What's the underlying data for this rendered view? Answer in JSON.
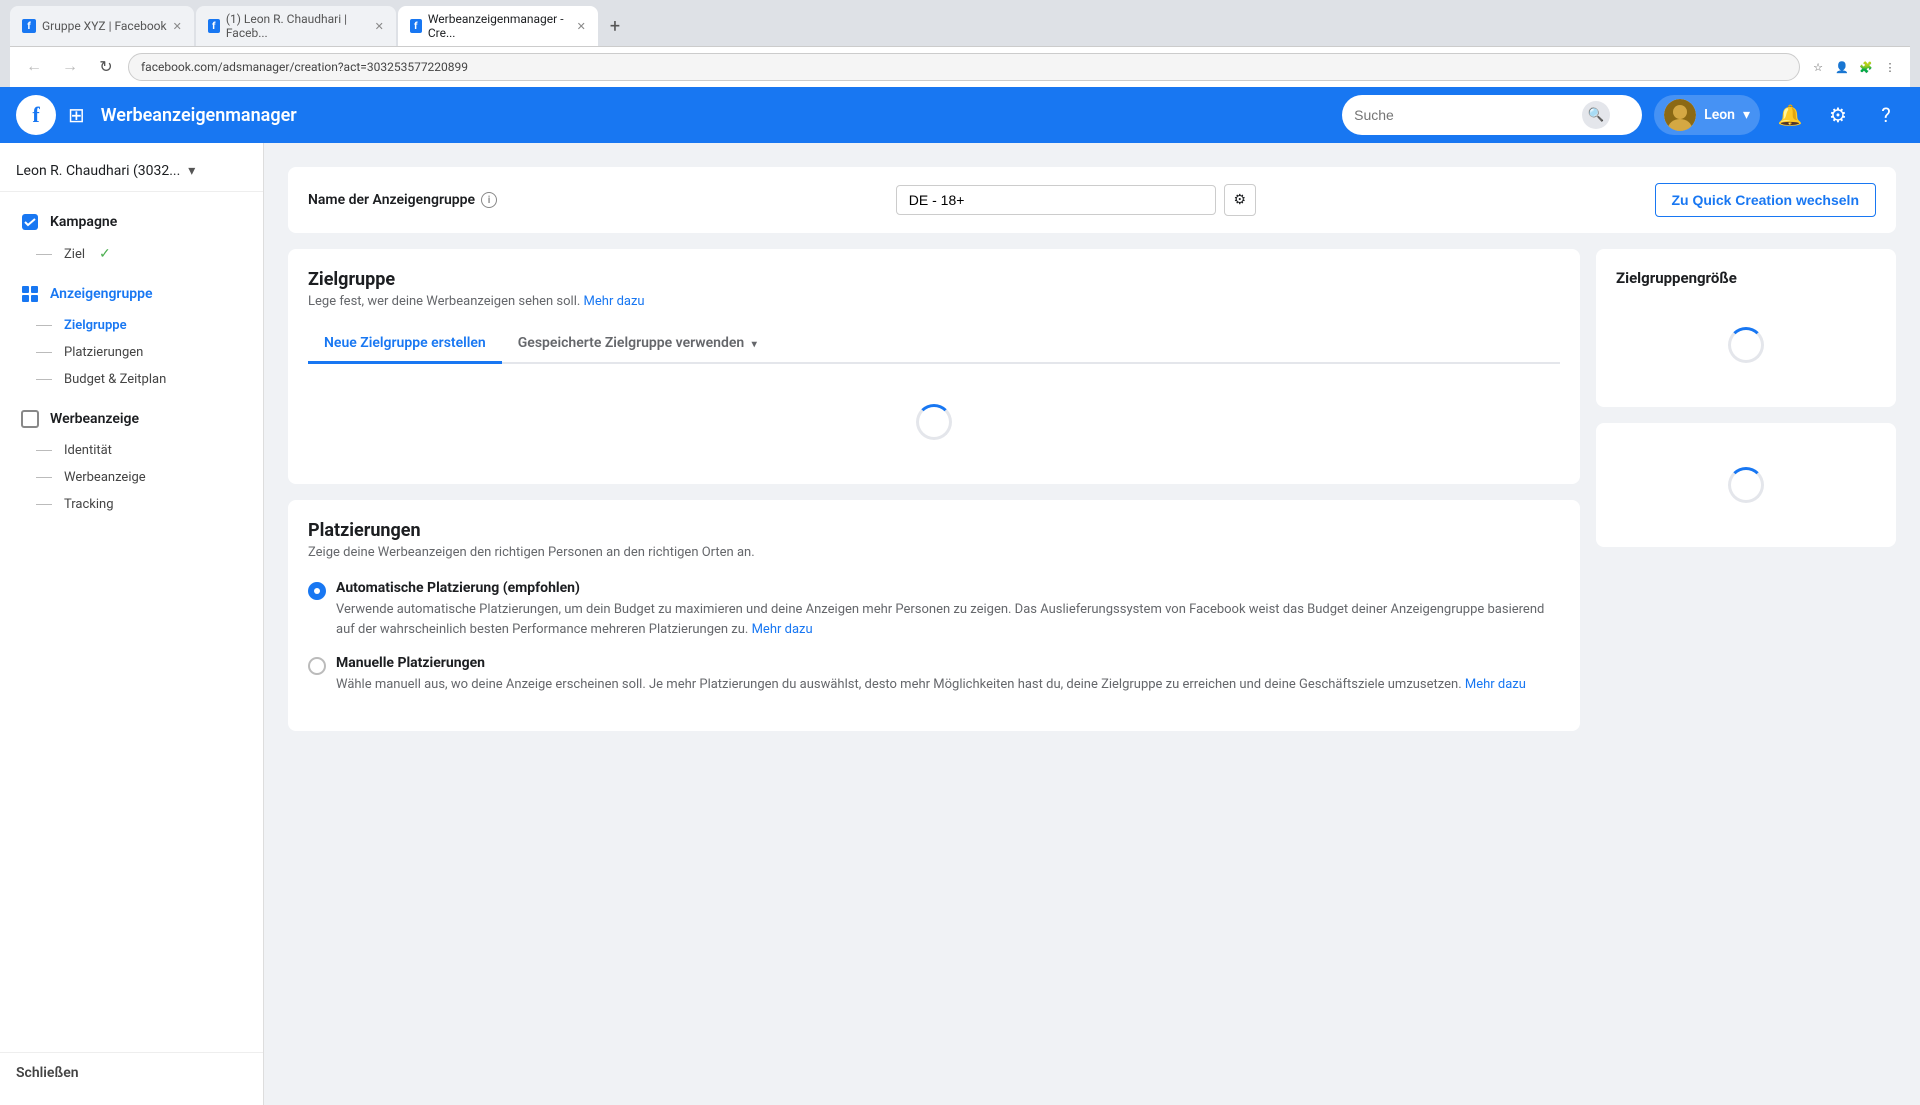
{
  "browser": {
    "tabs": [
      {
        "id": "tab1",
        "label": "Gruppe XYZ | Facebook",
        "favicon_color": "#1877f2",
        "favicon_text": "f",
        "active": false
      },
      {
        "id": "tab2",
        "label": "(1) Leon R. Chaudhari | Faceb...",
        "favicon_color": "#1877f2",
        "favicon_text": "f",
        "active": false
      },
      {
        "id": "tab3",
        "label": "Werbeanzeigenmanager - Cre...",
        "favicon_color": "#1877f2",
        "favicon_text": "f",
        "active": true
      }
    ],
    "new_tab_label": "+",
    "url": "facebook.com/adsmanager/creation?act=303253577220899"
  },
  "header": {
    "app_name": "Werbeanzeigenmanager",
    "search_placeholder": "Suche",
    "user_name": "Leon",
    "notifications_icon": "bell-icon",
    "settings_icon": "gear-icon",
    "help_icon": "question-icon"
  },
  "sidebar": {
    "account_name": "Leon R. Chaudhari (3032...",
    "sections": [
      {
        "id": "kampagne",
        "label": "Kampagne",
        "icon": "checkbox-icon",
        "sub_items": [
          {
            "id": "ziel",
            "label": "Ziel",
            "status": "done",
            "active": false
          }
        ]
      },
      {
        "id": "anzeigengruppe",
        "label": "Anzeigengruppe",
        "icon": "grid-icon",
        "sub_items": [
          {
            "id": "zielgruppe",
            "label": "Zielgruppe",
            "status": "",
            "active": true
          },
          {
            "id": "platzierungen",
            "label": "Platzierungen",
            "status": "",
            "active": false
          },
          {
            "id": "budget-zeitplan",
            "label": "Budget & Zeitplan",
            "status": "",
            "active": false
          }
        ]
      },
      {
        "id": "werbeanzeige",
        "label": "Werbeanzeige",
        "icon": "square-icon",
        "sub_items": [
          {
            "id": "identitaet",
            "label": "Identität",
            "status": "",
            "active": false
          },
          {
            "id": "werbeanzeige-item",
            "label": "Werbeanzeige",
            "status": "",
            "active": false
          },
          {
            "id": "tracking",
            "label": "Tracking",
            "status": "",
            "active": false
          }
        ]
      }
    ],
    "close_label": "Schließen"
  },
  "ad_name_bar": {
    "label": "Name der Anzeigengruppe",
    "value": "DE - 18+",
    "quick_creation_label": "Zu Quick Creation wechseln"
  },
  "zielgruppe": {
    "title": "Zielgruppe",
    "subtitle": "Lege fest, wer deine Werbeanzeigen sehen soll.",
    "mehr_dazu_label": "Mehr dazu",
    "tabs": [
      {
        "id": "neue",
        "label": "Neue Zielgruppe erstellen",
        "active": true
      },
      {
        "id": "gespeicherte",
        "label": "Gespeicherte Zielgruppe verwenden",
        "active": false,
        "has_chevron": true
      }
    ]
  },
  "zielgruppen_groesse": {
    "title": "Zielgruppengröße"
  },
  "platzierungen": {
    "title": "Platzierungen",
    "subtitle": "Zeige deine Werbeanzeigen den richtigen Personen an den richtigen Orten an.",
    "options": [
      {
        "id": "automatisch",
        "label": "Automatische Platzierung (empfohlen)",
        "selected": true,
        "desc_before": "Verwende automatische Platzierungen, um dein Budget zu maximieren und deine Anzeigen mehr Personen zu zeigen. Das Auslieferungssystem von Facebook weist das Budget deiner Anzeigengruppe basierend auf der wahrscheinlich besten Performance mehreren Platzierungen zu.",
        "mehr_dazu_label": "Mehr dazu"
      },
      {
        "id": "manuell",
        "label": "Manuelle Platzierungen",
        "selected": false,
        "desc_before": "Wähle manuell aus, wo deine Anzeige erscheinen soll. Je mehr Platzierungen du auswählst, desto mehr Möglichkeiten hast du, deine Zielgruppe zu erreichen und deine Geschäftsziele umzusetzen.",
        "mehr_dazu_label": "Mehr dazu"
      }
    ]
  },
  "colors": {
    "fb_blue": "#1877f2",
    "text_secondary": "#65676b",
    "border": "#ddd",
    "bg": "#f0f2f5"
  }
}
